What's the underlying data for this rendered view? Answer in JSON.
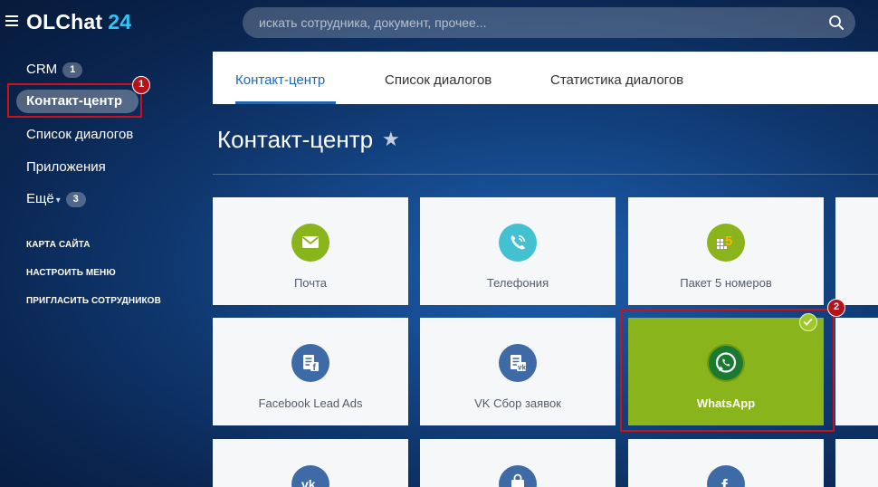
{
  "app": {
    "logo_main": "OLChat",
    "logo_num": "24"
  },
  "search": {
    "placeholder": "искать сотрудника, документ, прочее..."
  },
  "sidebar": {
    "items": [
      {
        "label": "CRM",
        "badge": "1"
      },
      {
        "label": "Контакт-центр"
      },
      {
        "label": "Список диалогов"
      },
      {
        "label": "Приложения"
      },
      {
        "label": "Ещё",
        "badge": "3"
      }
    ],
    "links": [
      "КАРТА САЙТА",
      "НАСТРОИТЬ МЕНЮ",
      "ПРИГЛАСИТЬ СОТРУДНИКОВ"
    ]
  },
  "tabs": [
    "Контакт-центр",
    "Список диалогов",
    "Статистика диалогов"
  ],
  "page": {
    "title": "Контакт-центр",
    "star": "★"
  },
  "tiles": [
    {
      "label": "Почта",
      "icon": "mail-icon",
      "color": "#8ab41b"
    },
    {
      "label": "Телефония",
      "icon": "phone-icon",
      "color": "#44c1d1"
    },
    {
      "label": "Пакет 5 номеров",
      "icon": "five-numbers-icon",
      "color": "#8ab41b",
      "icon_text": "5"
    },
    {
      "label": "Facebook Lead Ads",
      "icon": "facebook-leads-icon",
      "color": "#3e6aa5"
    },
    {
      "label": "VK Сбор заявок",
      "icon": "vk-leads-icon",
      "color": "#3e6aa5"
    },
    {
      "label": "WhatsApp",
      "icon": "whatsapp-icon",
      "color": "#8ab41b",
      "selected": true
    }
  ],
  "markers": [
    "1",
    "2"
  ]
}
